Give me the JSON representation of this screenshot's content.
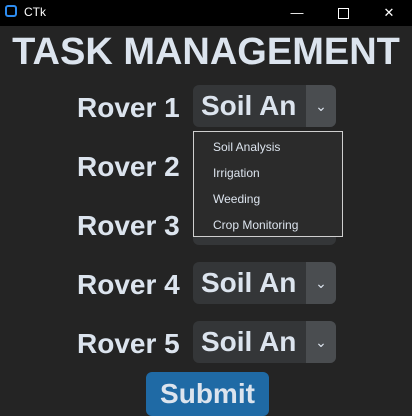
{
  "window": {
    "title": "CTk",
    "minimize_glyph": "—",
    "close_glyph": "✕"
  },
  "heading": "TASK MANAGEMENT",
  "rovers": [
    {
      "label": "Rover 1",
      "selected": "Soil An"
    },
    {
      "label": "Rover 2",
      "selected": ""
    },
    {
      "label": "Rover 3",
      "selected": ""
    },
    {
      "label": "Rover 4",
      "selected": "Soil An"
    },
    {
      "label": "Rover 5",
      "selected": "Soil An"
    }
  ],
  "dropdown_arrow": "⌄",
  "dropdown_options": [
    "Soil Analysis",
    "Irrigation",
    "Weeding",
    "Crop Monitoring"
  ],
  "submit_label": "Submit",
  "colors": {
    "background": "#242424",
    "accent": "#1f6aa5",
    "text": "#dce4ee",
    "combo_bg": "#343638"
  }
}
